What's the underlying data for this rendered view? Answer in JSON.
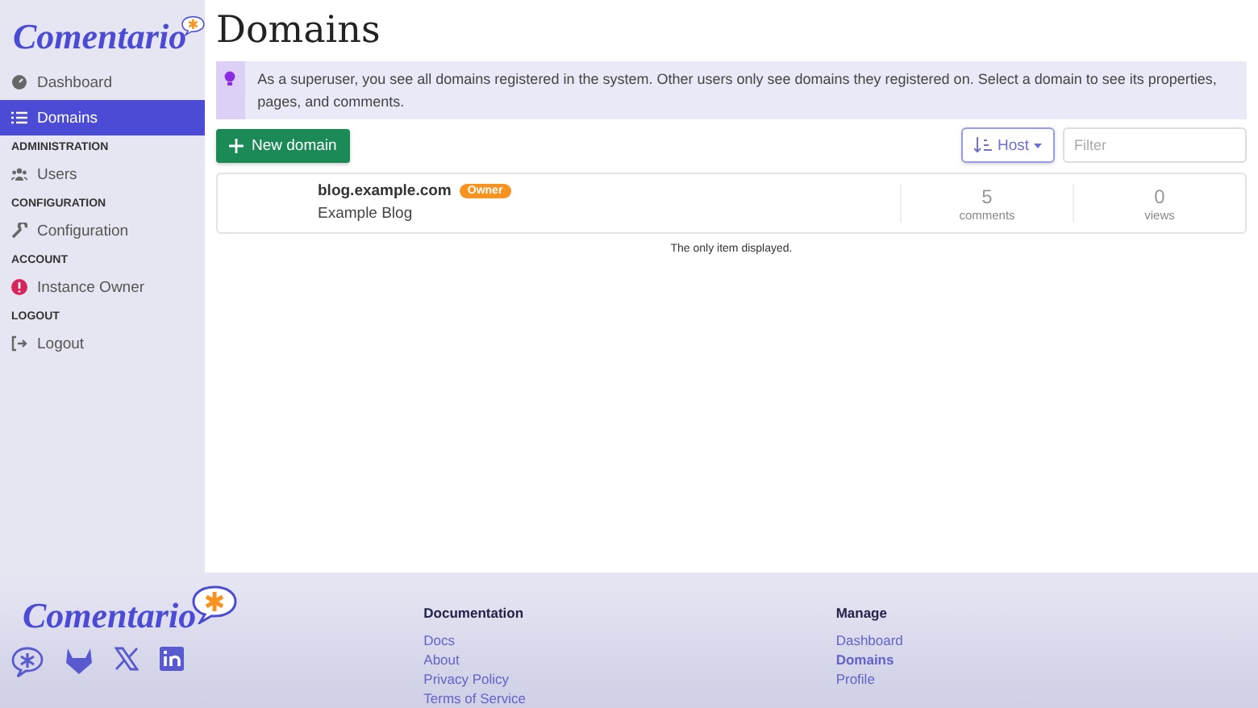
{
  "sidebar": {
    "logo": "Comentario",
    "sections": [
      {
        "items": [
          {
            "label": "Dashboard",
            "selected": false
          },
          {
            "label": "Domains",
            "selected": true
          }
        ]
      },
      {
        "heading": "ADMINISTRATION",
        "items": [
          {
            "label": "Users",
            "selected": false
          }
        ]
      },
      {
        "heading": "CONFIGURATION",
        "items": [
          {
            "label": "Configuration",
            "selected": false
          }
        ]
      },
      {
        "heading": "ACCOUNT",
        "items": [
          {
            "label": "Instance Owner",
            "selected": false
          }
        ]
      },
      {
        "heading": "LOGOUT",
        "items": [
          {
            "label": "Logout",
            "selected": false
          }
        ]
      }
    ]
  },
  "page": {
    "title": "Domains",
    "notice": "As a superuser, you see all domains registered in the system. Other users only see domains they registered on. Select a domain to see its properties, pages, and comments.",
    "new_button": "New domain",
    "sort_button": "Host",
    "filter": {
      "placeholder": "Filter"
    },
    "domains": [
      {
        "host": "blog.example.com",
        "badge": "Owner",
        "name": "Example Blog",
        "comments": "5",
        "comments_label": "comments",
        "views": "0",
        "views_label": "views"
      }
    ],
    "footnote": "The only item displayed."
  },
  "footer": {
    "logo": "Comentario",
    "columns": [
      {
        "heading": "Documentation",
        "links": [
          {
            "label": "Docs",
            "selected": false
          },
          {
            "label": "About",
            "selected": false
          },
          {
            "label": "Privacy Policy",
            "selected": false
          },
          {
            "label": "Terms of Service",
            "selected": false
          }
        ]
      },
      {
        "heading": "Manage",
        "links": [
          {
            "label": "Dashboard",
            "selected": false
          },
          {
            "label": "Domains",
            "selected": true
          },
          {
            "label": "Profile",
            "selected": false
          }
        ]
      }
    ]
  }
}
